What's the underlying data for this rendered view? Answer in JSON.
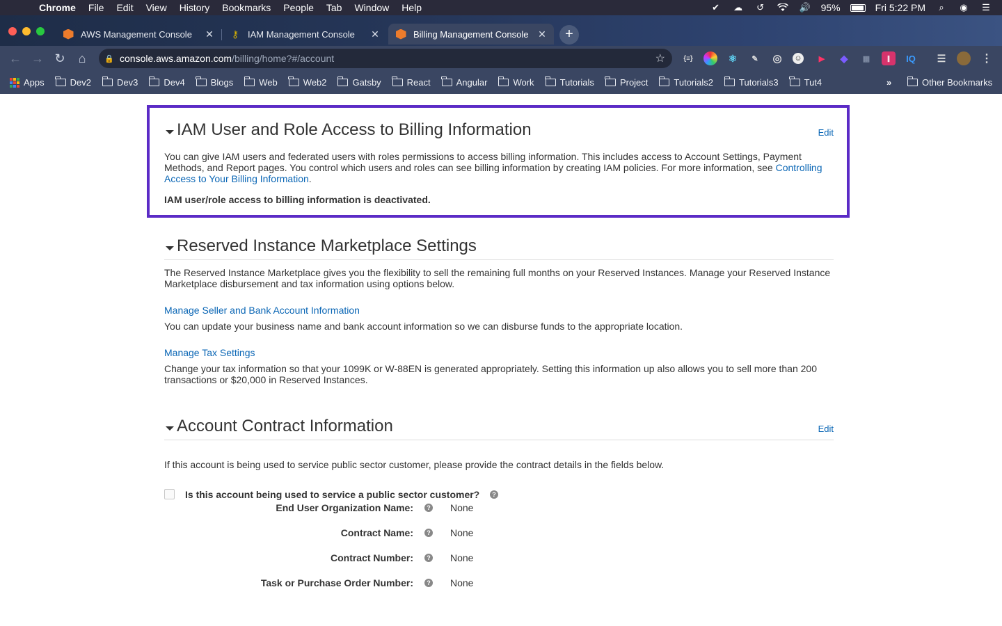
{
  "menubar": {
    "app_name": "Chrome",
    "items": [
      "File",
      "Edit",
      "View",
      "History",
      "Bookmarks",
      "People",
      "Tab",
      "Window",
      "Help"
    ],
    "battery": "95%",
    "clock": "Fri 5:22 PM"
  },
  "tabs": [
    {
      "title": "AWS Management Console",
      "icon": "aws-cube-icon"
    },
    {
      "title": "IAM Management Console",
      "icon": "key-icon"
    },
    {
      "title": "Billing Management Console",
      "icon": "aws-cube-icon",
      "active": true
    }
  ],
  "address_bar": {
    "host": "console.aws.amazon.com",
    "path": "/billing/home?#/account"
  },
  "bookmarks": {
    "apps_label": "Apps",
    "folders": [
      "Dev2",
      "Dev3",
      "Dev4",
      "Blogs",
      "Web",
      "Web2",
      "Gatsby",
      "React",
      "Angular",
      "Work",
      "Tutorials",
      "Project",
      "Tutorials2",
      "Tutorials3",
      "Tut4"
    ],
    "overflow": "»",
    "other": "Other Bookmarks"
  },
  "iam_section": {
    "title": "IAM User and Role Access to Billing Information",
    "edit": "Edit",
    "description": "You can give IAM users and federated users with roles permissions to access billing information. This includes access to Account Settings, Payment Methods, and Report pages. You control which users and roles can see billing information by creating IAM policies. For more information, see ",
    "link_text": "Controlling Access to Your Billing Information",
    "period": ".",
    "status": "IAM user/role access to billing information is deactivated."
  },
  "ri_section": {
    "title": "Reserved Instance Marketplace Settings",
    "description": "The Reserved Instance Marketplace gives you the flexibility to sell the remaining full months on your Reserved Instances. Manage your Reserved Instance Marketplace disbursement and tax information using options below.",
    "seller_link": "Manage Seller and Bank Account Information",
    "seller_desc": "You can update your business name and bank account information so we can disburse funds to the appropriate location.",
    "tax_link": "Manage Tax Settings",
    "tax_desc": "Change your tax information so that your 1099K or W-88EN is generated appropriately. Setting this information up also allows you to sell more than 200 transactions or $20,000 in Reserved Instances."
  },
  "contract_section": {
    "title": "Account Contract Information",
    "edit": "Edit",
    "description": "If this account is being used to service public sector customer, please provide the contract details in the fields below.",
    "checkbox_label": "Is this account being used to service a public sector customer?",
    "checkbox_checked": false,
    "fields": [
      {
        "label": "End User Organization Name:",
        "value": "None"
      },
      {
        "label": "Contract Name:",
        "value": "None"
      },
      {
        "label": "Contract Number:",
        "value": "None"
      },
      {
        "label": "Task or Purchase Order Number:",
        "value": "None"
      }
    ]
  },
  "colors": {
    "link": "#0a66b5",
    "highlight_border": "#5b2bc6",
    "aws_orange": "#ed7c2c"
  }
}
